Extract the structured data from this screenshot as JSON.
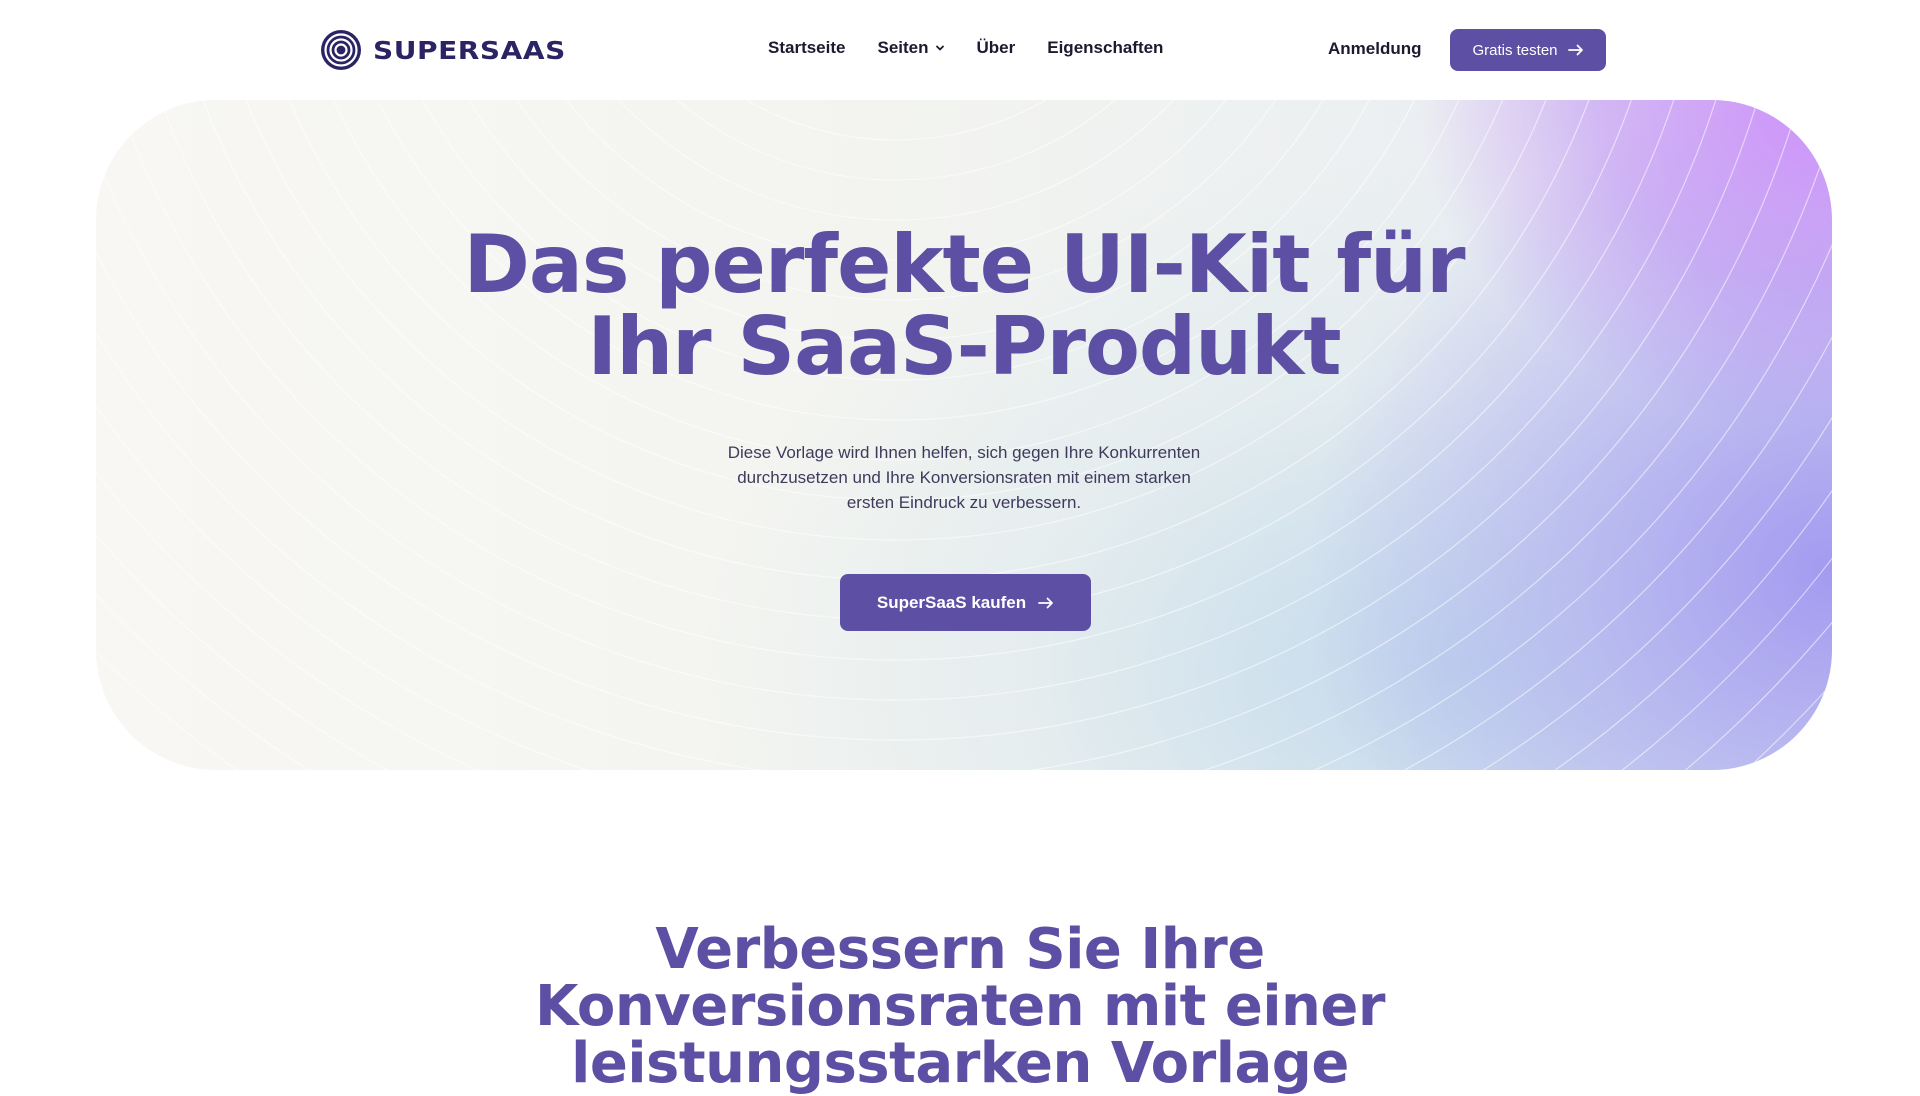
{
  "brand": {
    "name": "SUPERSAAS",
    "logo_icon": "concentric-circles-logo"
  },
  "nav": {
    "items": [
      {
        "label": "Startseite"
      },
      {
        "label": "Seiten",
        "has_dropdown": true
      },
      {
        "label": "Über"
      },
      {
        "label": "Eigenschaften"
      }
    ],
    "login_label": "Anmeldung",
    "cta_label": "Gratis testen"
  },
  "hero": {
    "title_line1": "Das perfekte UI-Kit für",
    "title_line2": "Ihr SaaS-Produkt",
    "subtitle": "Diese Vorlage wird Ihnen helfen, sich gegen Ihre Konkurrenten durchzusetzen und Ihre Konversionsraten mit einem starken ersten Eindruck zu verbessern.",
    "cta_label": "SuperSaaS kaufen"
  },
  "section": {
    "title": "Verbessern Sie Ihre\nKonversionsraten mit einer\nleistungsstarken Vorlage"
  },
  "colors": {
    "primary": "#5d4fa3",
    "brand_text": "#2b2464",
    "nav_text": "#1c1a2e"
  }
}
